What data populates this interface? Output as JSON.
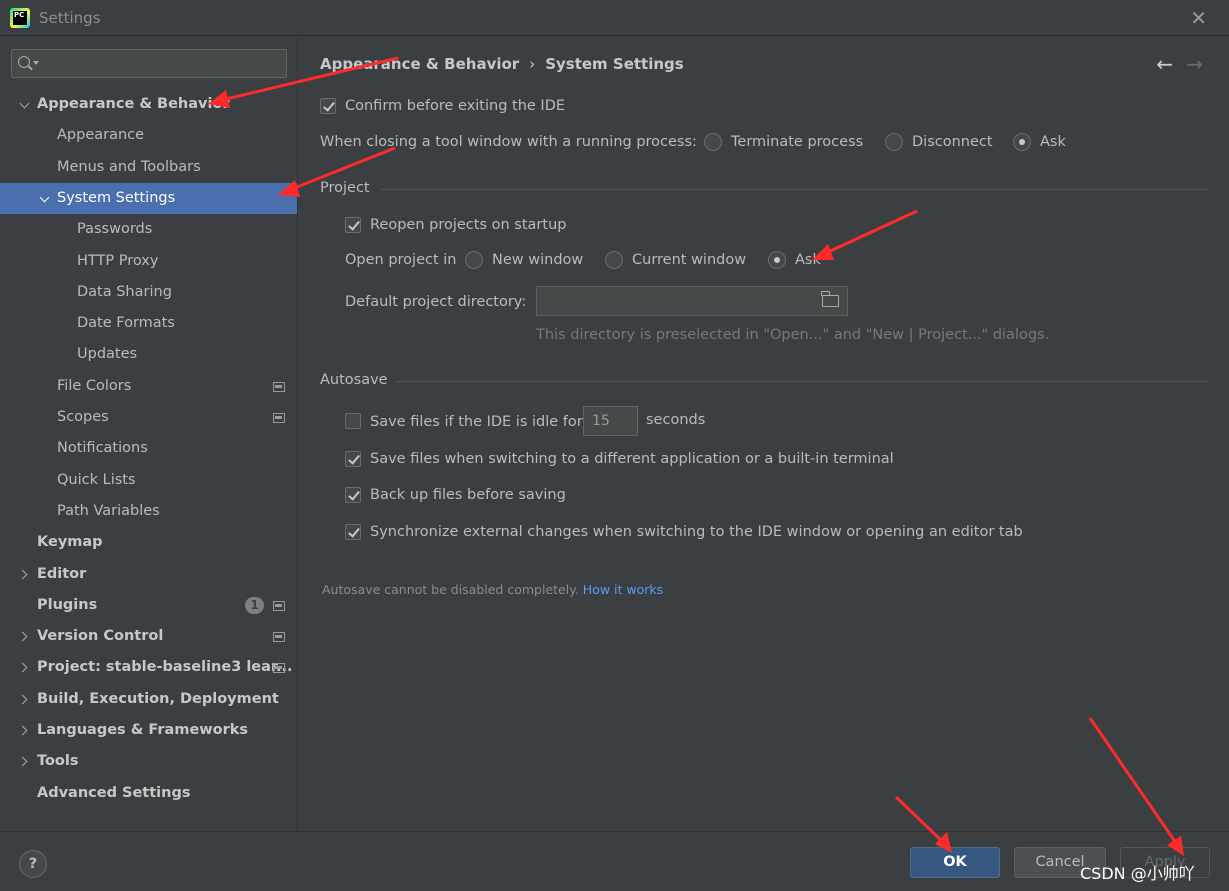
{
  "window": {
    "title": "Settings",
    "app_logo_text": "PC"
  },
  "sidebar": {
    "search_placeholder": "",
    "items": [
      {
        "label": "Appearance & Behavior",
        "bold": true,
        "chevron": "down"
      },
      {
        "label": "Appearance"
      },
      {
        "label": "Menus and Toolbars"
      },
      {
        "label": "System Settings",
        "chevron": "down",
        "selected": true
      },
      {
        "label": "Passwords"
      },
      {
        "label": "HTTP Proxy"
      },
      {
        "label": "Data Sharing"
      },
      {
        "label": "Date Formats"
      },
      {
        "label": "Updates"
      },
      {
        "label": "File Colors",
        "project_icon": true
      },
      {
        "label": "Scopes",
        "project_icon": true
      },
      {
        "label": "Notifications"
      },
      {
        "label": "Quick Lists"
      },
      {
        "label": "Path Variables"
      },
      {
        "label": "Keymap",
        "bold": true
      },
      {
        "label": "Editor",
        "bold": true,
        "chevron": "right"
      },
      {
        "label": "Plugins",
        "bold": true,
        "badge": "1",
        "project_icon": true
      },
      {
        "label": "Version Control",
        "bold": true,
        "chevron": "right",
        "project_icon": true
      },
      {
        "label": "Project: stable-baseline3 lear...",
        "bold": true,
        "chevron": "right",
        "project_icon": true
      },
      {
        "label": "Build, Execution, Deployment",
        "bold": true,
        "chevron": "right"
      },
      {
        "label": "Languages & Frameworks",
        "bold": true,
        "chevron": "right"
      },
      {
        "label": "Tools",
        "bold": true,
        "chevron": "right"
      },
      {
        "label": "Advanced Settings",
        "bold": true
      }
    ]
  },
  "breadcrumb": {
    "parent": "Appearance & Behavior",
    "separator": "›",
    "current": "System Settings",
    "back_glyph": "←",
    "forward_glyph": "→"
  },
  "general": {
    "confirm_exit_label": "Confirm before exiting the IDE",
    "confirm_exit_checked": true,
    "closing_tool_window_label": "When closing a tool window with a running process:",
    "closing_options": [
      "Terminate process",
      "Disconnect",
      "Ask"
    ],
    "closing_selected": "Ask"
  },
  "project": {
    "section_title": "Project",
    "reopen_label": "Reopen projects on startup",
    "reopen_checked": true,
    "open_in_label": "Open project in",
    "open_options": [
      "New window",
      "Current window",
      "Ask"
    ],
    "open_selected": "Ask",
    "default_dir_label": "Default project directory:",
    "default_dir_value": "",
    "default_dir_hint": "This directory is preselected in \"Open...\" and \"New | Project...\" dialogs."
  },
  "autosave": {
    "section_title": "Autosave",
    "idle_label": "Save files if the IDE is idle for",
    "idle_checked": false,
    "idle_seconds": "15",
    "idle_unit": "seconds",
    "switching_label": "Save files when switching to a different application or a built-in terminal",
    "switching_checked": true,
    "backup_label": "Back up files before saving",
    "backup_checked": true,
    "sync_label": "Synchronize external changes when switching to the IDE window or opening an editor tab",
    "sync_checked": true,
    "note": "Autosave cannot be disabled completely.",
    "note_link": "How it works"
  },
  "footer": {
    "help_label": "?",
    "ok_label": "OK",
    "cancel_label": "Cancel",
    "apply_label": "Apply"
  },
  "watermark": "CSDN @小帅吖",
  "colors": {
    "background": "#3c3f41",
    "selection": "#4b6eaf",
    "ok_button": "#365880",
    "link": "#589df6",
    "annotation_arrow": "#ff2a2a"
  }
}
